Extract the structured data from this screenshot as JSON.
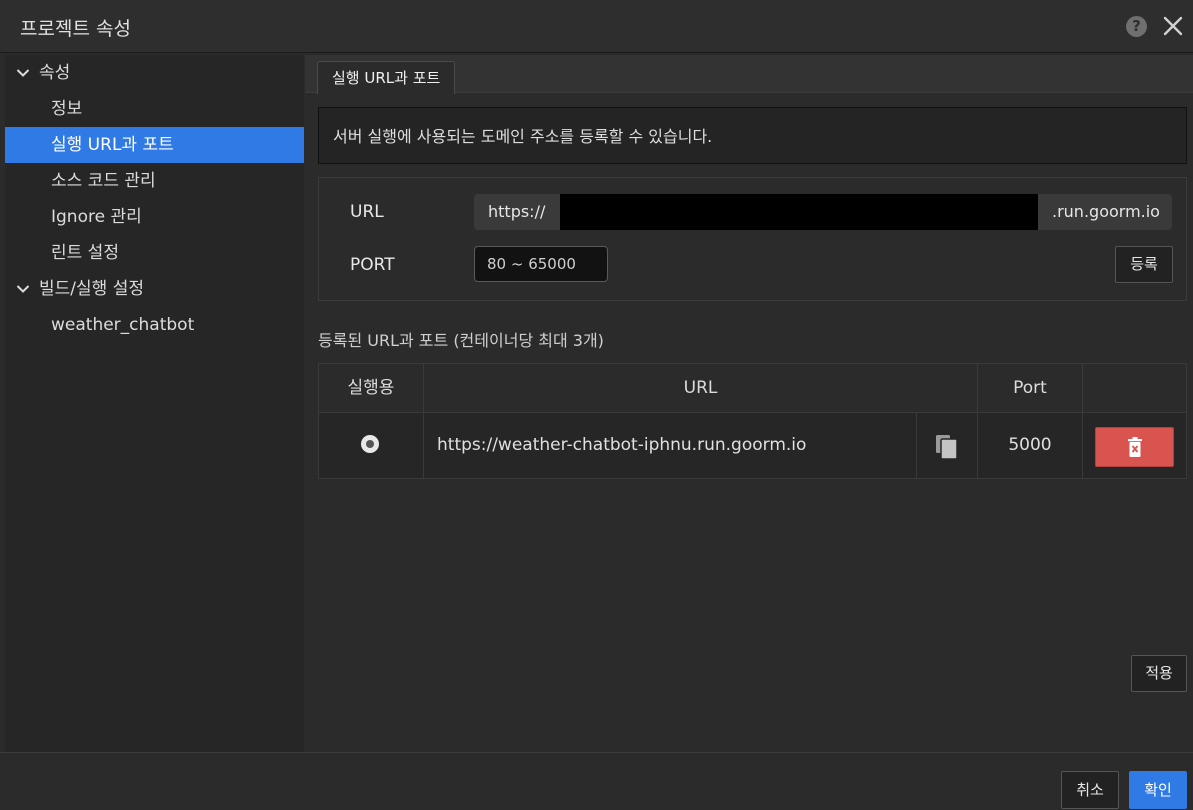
{
  "dialog": {
    "title": "프로젝트 속성",
    "help_glyph": "?"
  },
  "sidebar": {
    "groups": [
      {
        "label": "속성",
        "items": [
          {
            "label": "정보"
          },
          {
            "label": "실행 URL과 포트",
            "active": true
          },
          {
            "label": "소스 코드 관리"
          },
          {
            "label": "Ignore 관리"
          },
          {
            "label": "린트 설정"
          }
        ]
      },
      {
        "label": "빌드/실행 설정",
        "items": [
          {
            "label": "weather_chatbot"
          }
        ]
      }
    ]
  },
  "content": {
    "tab_label": "실행 URL과 포트",
    "info_text": "서버 실행에 사용되는 도메인 주소를 등록할 수 있습니다.",
    "form": {
      "url_label": "URL",
      "url_prefix": "https://",
      "url_value": "",
      "url_suffix": ".run.goorm.io",
      "port_label": "PORT",
      "port_placeholder": "80 ~ 65000",
      "register_label": "등록"
    },
    "registered_title": "등록된 URL과 포트 (컨테이너당 최대 3개)",
    "table": {
      "headers": {
        "run": "실행용",
        "url": "URL",
        "port": "Port"
      },
      "rows": [
        {
          "url": "https://weather-chatbot-iphnu.run.goorm.io",
          "port": "5000",
          "selected": true
        }
      ]
    },
    "apply_label": "적용"
  },
  "footer": {
    "cancel_label": "취소",
    "ok_label": "확인"
  },
  "colors": {
    "accent": "#2f7ae5",
    "danger": "#d9534f",
    "background": "#2b2b2b"
  }
}
